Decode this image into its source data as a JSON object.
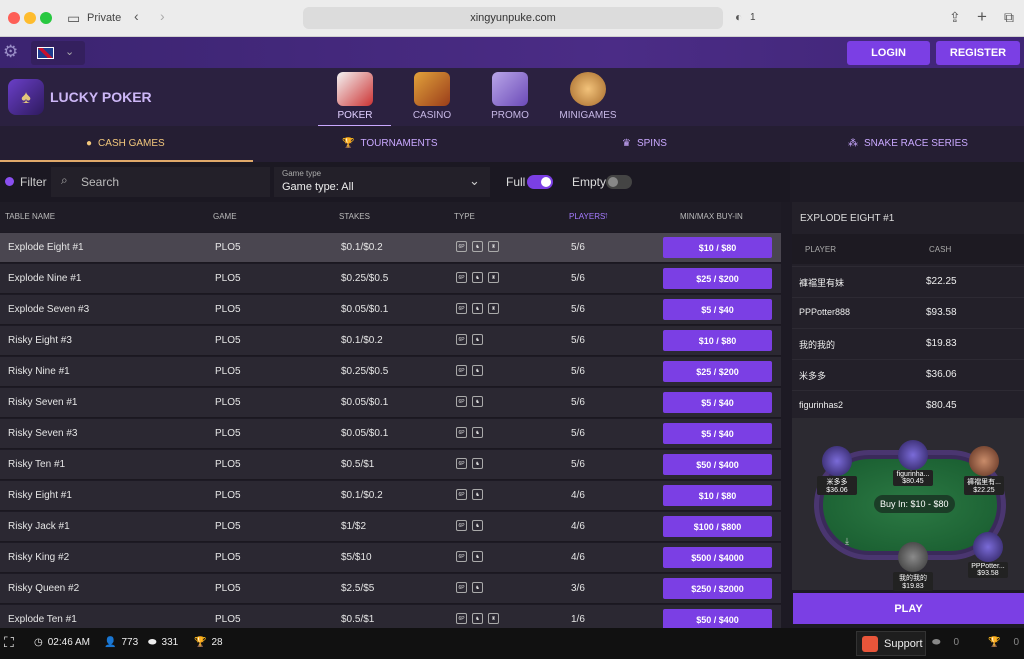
{
  "browser": {
    "private_label": "Private",
    "url": "xingyunpuke.com",
    "shield_count": "1"
  },
  "topbar": {
    "login": "LOGIN",
    "register": "REGISTER"
  },
  "brand": {
    "logo_text": "LUCKY POKER"
  },
  "nav": [
    {
      "label": "POKER"
    },
    {
      "label": "CASINO"
    },
    {
      "label": "PROMO"
    },
    {
      "label": "MINIGAMES"
    }
  ],
  "tabs": [
    {
      "label": "CASH GAMES"
    },
    {
      "label": "TOURNAMENTS"
    },
    {
      "label": "SPINS"
    },
    {
      "label": "SNAKE RACE SERIES"
    }
  ],
  "filters": {
    "filter_label": "Filter",
    "search_placeholder": "Search",
    "game_type_caption": "Game type",
    "game_type_value": "Game type: All",
    "full_label": "Full",
    "empty_label": "Empty"
  },
  "table": {
    "headers": [
      "TABLE NAME",
      "GAME",
      "STAKES",
      "TYPE",
      "PLAYERS",
      "MIN/MAX BUY-IN"
    ],
    "rows": [
      {
        "name": "Explode Eight #1",
        "game": "PLO5",
        "stakes": "$0.1/$0.2",
        "players": "5/6",
        "buyin": "$10 / $80",
        "types": 3
      },
      {
        "name": "Explode Nine #1",
        "game": "PLO5",
        "stakes": "$0.25/$0.5",
        "players": "5/6",
        "buyin": "$25 / $200",
        "types": 3
      },
      {
        "name": "Explode Seven #3",
        "game": "PLO5",
        "stakes": "$0.05/$0.1",
        "players": "5/6",
        "buyin": "$5 / $40",
        "types": 3
      },
      {
        "name": "Risky Eight #3",
        "game": "PLO5",
        "stakes": "$0.1/$0.2",
        "players": "5/6",
        "buyin": "$10 / $80",
        "types": 2
      },
      {
        "name": "Risky Nine #1",
        "game": "PLO5",
        "stakes": "$0.25/$0.5",
        "players": "5/6",
        "buyin": "$25 / $200",
        "types": 2
      },
      {
        "name": "Risky Seven #1",
        "game": "PLO5",
        "stakes": "$0.05/$0.1",
        "players": "5/6",
        "buyin": "$5 / $40",
        "types": 2
      },
      {
        "name": "Risky Seven #3",
        "game": "PLO5",
        "stakes": "$0.05/$0.1",
        "players": "5/6",
        "buyin": "$5 / $40",
        "types": 2
      },
      {
        "name": "Risky Ten #1",
        "game": "PLO5",
        "stakes": "$0.5/$1",
        "players": "5/6",
        "buyin": "$50 / $400",
        "types": 2
      },
      {
        "name": "Risky Eight #1",
        "game": "PLO5",
        "stakes": "$0.1/$0.2",
        "players": "4/6",
        "buyin": "$10 / $80",
        "types": 2
      },
      {
        "name": "Risky Jack #1",
        "game": "PLO5",
        "stakes": "$1/$2",
        "players": "4/6",
        "buyin": "$100 / $800",
        "types": 2
      },
      {
        "name": "Risky King #2",
        "game": "PLO5",
        "stakes": "$5/$10",
        "players": "4/6",
        "buyin": "$500 / $4000",
        "types": 2
      },
      {
        "name": "Risky Queen #2",
        "game": "PLO5",
        "stakes": "$2.5/$5",
        "players": "3/6",
        "buyin": "$250 / $2000",
        "types": 2
      },
      {
        "name": "Explode Ten #1",
        "game": "PLO5",
        "stakes": "$0.5/$1",
        "players": "1/6",
        "buyin": "$50 / $400",
        "types": 3
      }
    ]
  },
  "side": {
    "title": "EXPLODE EIGHT #1",
    "col_player": "PLAYER",
    "col_cash": "CASH",
    "players": [
      {
        "name": "褲襠里有妹",
        "cash": "$22.25"
      },
      {
        "name": "PPPotter888",
        "cash": "$93.58"
      },
      {
        "name": "我的我的",
        "cash": "$19.83"
      },
      {
        "name": "米多多",
        "cash": "$36.06"
      },
      {
        "name": "figurinhas2",
        "cash": "$80.45"
      }
    ],
    "buyin_text": "Buy In: $10 - $80",
    "seats": [
      {
        "name": "米多多",
        "cash": "$36.06"
      },
      {
        "name": "figurinha...",
        "cash": "$80.45"
      },
      {
        "name": "褲襠里有...",
        "cash": "$22.25"
      },
      {
        "name": "我的我的",
        "cash": "$19.83"
      },
      {
        "name": "PPPotter...",
        "cash": "$93.58"
      }
    ],
    "play": "PLAY"
  },
  "bottom": {
    "time": "02:46 AM",
    "players_online": "773",
    "tables": "331",
    "tournaments": "28",
    "support": "Support",
    "chips": "0",
    "trophy": "0"
  }
}
